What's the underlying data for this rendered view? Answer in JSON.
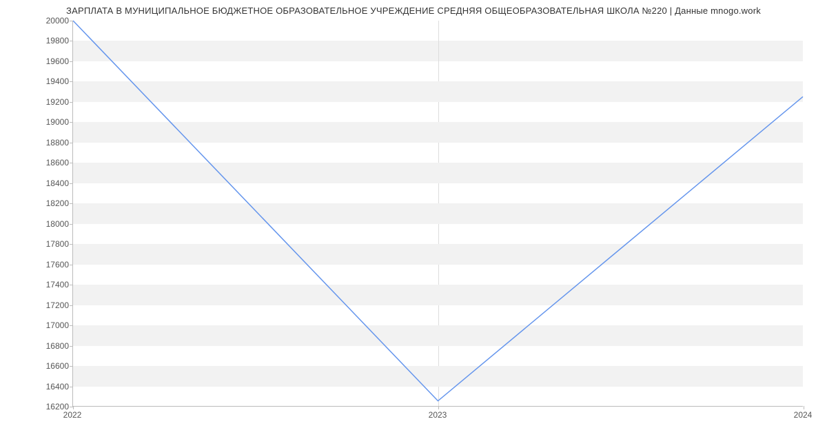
{
  "chart_data": {
    "type": "line",
    "title": "ЗАРПЛАТА В МУНИЦИПАЛЬНОЕ БЮДЖЕТНОЕ ОБРАЗОВАТЕЛЬНОЕ УЧРЕЖДЕНИЕ СРЕДНЯЯ ОБЩЕОБРАЗОВАТЕЛЬНАЯ ШКОЛА №220 | Данные mnogo.work",
    "x": [
      "2022",
      "2023",
      "2024"
    ],
    "values": [
      20000,
      16250,
      19250
    ],
    "xlabel": "",
    "ylabel": "",
    "ylim": [
      16200,
      20000
    ],
    "yticks": [
      16200,
      16400,
      16600,
      16800,
      17000,
      17200,
      17400,
      17600,
      17800,
      18000,
      18200,
      18400,
      18600,
      18800,
      19000,
      19200,
      19400,
      19600,
      19800,
      20000
    ],
    "line_color": "#6495ED"
  }
}
